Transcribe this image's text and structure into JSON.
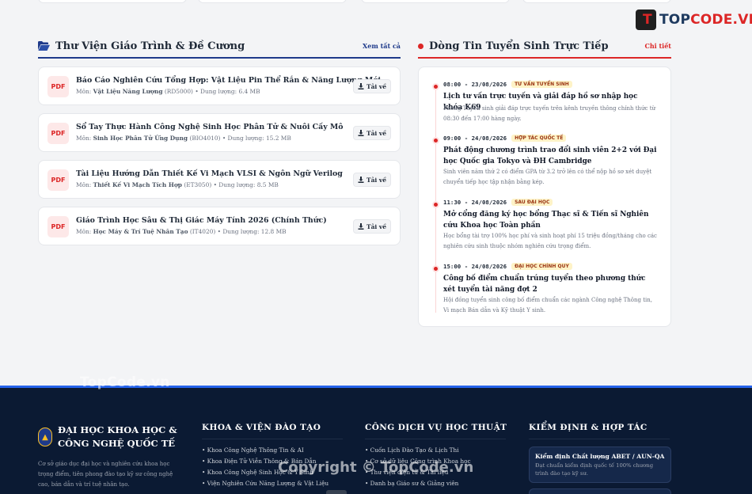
{
  "logo": {
    "prefix": "TOP",
    "suffix": "CODE.VN",
    "mark": "T"
  },
  "library": {
    "title": "Thư Viện Giáo Trình & Đề Cương",
    "more": "Xem tất cả",
    "items": [
      {
        "badge": "PDF",
        "title": "Báo Cáo Nghiên Cứu Tổng Hợp: Vật Liệu Pin Thể Rắn & Năng Lượng Mới",
        "label": "Môn:",
        "subject": "Vật Liệu Năng Lượng",
        "code": "(RD5000)",
        "size": "• Dung lượng: 6.4 MB",
        "download": "Tải về"
      },
      {
        "badge": "PDF",
        "title": "Sổ Tay Thực Hành Công Nghệ Sinh Học Phân Tử & Nuôi Cấy Mô",
        "label": "Môn:",
        "subject": "Sinh Học Phân Tử Ứng Dụng",
        "code": "(BIO4010)",
        "size": "• Dung lượng: 15.2 MB",
        "download": "Tải về"
      },
      {
        "badge": "PDF",
        "title": "Tài Liệu Hướng Dẫn Thiết Kế Vi Mạch VLSI & Ngôn Ngữ Verilog",
        "label": "Môn:",
        "subject": "Thiết Kế Vi Mạch Tích Hợp",
        "code": "(ET3050)",
        "size": "• Dung lượng: 8.5 MB",
        "download": "Tải về"
      },
      {
        "badge": "PDF",
        "title": "Giáo Trình Học Sâu & Thị Giác Máy Tính 2026 (Chính Thức)",
        "label": "Môn:",
        "subject": "Học Máy & Trí Tuệ Nhân Tạo",
        "code": "(IT4020)",
        "size": "• Dung lượng: 12.8 MB",
        "download": "Tải về"
      }
    ]
  },
  "news": {
    "title": "Dòng Tin Tuyển Sinh Trực Tiếp",
    "more": "Chi tiết",
    "items": [
      {
        "time": "08:00 - 23/08/2026",
        "tag": "TƯ VẤN TUYỂN SINH",
        "headline": "Lịch tư vấn trực tuyến và giải đáp hồ sơ nhập học khóa K69",
        "desc": "Phòng Tuyển sinh giải đáp trực tuyến trên kênh truyền thông chính thức từ 08:30 đến 17:00 hàng ngày."
      },
      {
        "time": "09:00 - 24/08/2026",
        "tag": "HỢP TÁC QUỐC TẾ",
        "headline": "Phát động chương trình trao đổi sinh viên 2+2 với Đại học Quốc gia Tokyo và ĐH Cambridge",
        "desc": "Sinh viên năm thứ 2 có điểm GPA từ 3.2 trở lên có thể nộp hồ sơ xét duyệt chuyển tiếp học tập nhận bằng kép."
      },
      {
        "time": "11:30 - 24/08/2026",
        "tag": "SAU ĐẠI HỌC",
        "headline": "Mở cổng đăng ký học bổng Thạc sĩ & Tiến sĩ Nghiên cứu Khoa học Toàn phần",
        "desc": "Học bổng tài trợ 100% học phí và sinh hoạt phí 15 triệu đồng/tháng cho các nghiên cứu sinh thuộc nhóm nghiên cứu trọng điểm."
      },
      {
        "time": "15:00 - 24/08/2026",
        "tag": "ĐẠI HỌC CHÍNH QUY",
        "headline": "Công bố điểm chuẩn trúng tuyển theo phương thức xét tuyển tài năng đợt 2",
        "desc": "Hội đồng tuyển sinh công bố điểm chuẩn các ngành Công nghệ Thông tin, Vi mạch Bán dẫn và Kỹ thuật Y sinh."
      }
    ]
  },
  "footer": {
    "brand": "ĐẠI HỌC KHOA HỌC & CÔNG NGHỆ QUỐC TẾ",
    "brand_desc": "Cơ sở giáo dục đại học và nghiên cứu khoa học trọng điểm, tiên phong đào tạo kỹ sư công nghệ cao, bán dẫn và trí tuệ nhân tạo.",
    "col1": {
      "title": "KHOA & VIỆN ĐÀO TẠO",
      "links": [
        "• Khoa Công Nghệ Thông Tin & AI",
        "• Khoa Điện Tử Viễn Thông & Bán Dẫn",
        "• Khoa Công Nghệ Sinh Học & Y Sinh",
        "• Viện Nghiên Cứu Năng Lượng & Vật Liệu"
      ]
    },
    "col2": {
      "title": "CÔNG DỊCH VỤ HỌC THUẬT",
      "links": [
        "• Cuốn Lịch Đào Tạo & Lịch Thi",
        "• Cơ sở dữ liệu Công trình Khoa học",
        "• Thư viện điện tử & Tài liệu",
        "• Danh bạ Giáo sư & Giảng viên"
      ]
    },
    "col3": {
      "title": "KIỂM ĐỊNH & HỢP TÁC",
      "card_title": "Kiểm định Chất lượng ABET / AUN-QA",
      "card_desc": "Đạt chuẩn kiểm định quốc tế 100% chương trình đào tạo kỹ sư."
    }
  },
  "watermarks": {
    "top": "TopCode.vn",
    "bottom": "Copyright © TopCode.vn"
  }
}
